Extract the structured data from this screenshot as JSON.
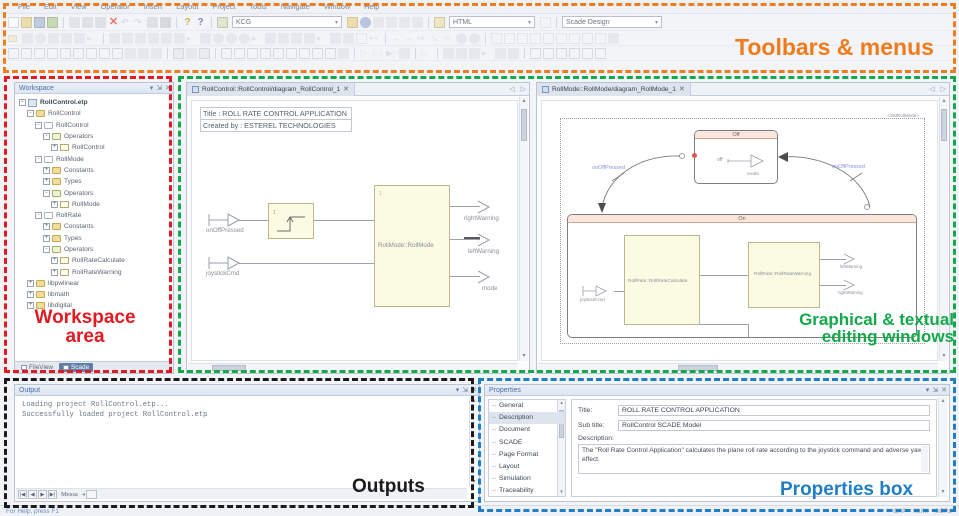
{
  "menubar": {
    "items": [
      "File",
      "Edit",
      "View",
      "Operator",
      "Insert",
      "Layout",
      "Project",
      "Tools",
      "Navigate",
      "Window",
      "Help"
    ]
  },
  "toolbar": {
    "kcg_combo": {
      "value": "KCG"
    },
    "html_combo": {
      "value": "HTML"
    },
    "design_combo": {
      "value": "Scade Design"
    }
  },
  "workspace": {
    "title": "Workspace",
    "tree": [
      {
        "label": "RollControl.etp",
        "depth": 0,
        "icon": "project",
        "expander": "-",
        "root": true
      },
      {
        "label": "RollControl",
        "depth": 1,
        "icon": "folder",
        "expander": "-"
      },
      {
        "label": "RollControl",
        "depth": 2,
        "icon": "white",
        "expander": "-"
      },
      {
        "label": "Operators",
        "depth": 3,
        "icon": "green",
        "expander": "-"
      },
      {
        "label": "RollControl",
        "depth": 4,
        "icon": "operator",
        "expander": "+"
      },
      {
        "label": "RollMode",
        "depth": 2,
        "icon": "white",
        "expander": "-"
      },
      {
        "label": "Constants",
        "depth": 3,
        "icon": "folder",
        "expander": "+"
      },
      {
        "label": "Types",
        "depth": 3,
        "icon": "folder",
        "expander": "+"
      },
      {
        "label": "Operators",
        "depth": 3,
        "icon": "green",
        "expander": "-"
      },
      {
        "label": "RollMode",
        "depth": 4,
        "icon": "operator",
        "expander": "+"
      },
      {
        "label": "RollRate",
        "depth": 2,
        "icon": "white",
        "expander": "-"
      },
      {
        "label": "Constants",
        "depth": 3,
        "icon": "folder",
        "expander": "+"
      },
      {
        "label": "Types",
        "depth": 3,
        "icon": "folder",
        "expander": "+"
      },
      {
        "label": "Operators",
        "depth": 3,
        "icon": "green",
        "expander": "-"
      },
      {
        "label": "RollRateCalculate",
        "depth": 4,
        "icon": "operator",
        "expander": "+"
      },
      {
        "label": "RollRateWarning",
        "depth": 4,
        "icon": "operator",
        "expander": "+"
      },
      {
        "label": "libpwlinear",
        "depth": 1,
        "icon": "folder",
        "expander": "+"
      },
      {
        "label": "libmath",
        "depth": 1,
        "icon": "folder",
        "expander": "+"
      },
      {
        "label": "libdigital",
        "depth": 1,
        "icon": "folder",
        "expander": "+"
      }
    ],
    "tabs": [
      {
        "label": "FileView",
        "selected": false
      },
      {
        "label": "Scade",
        "selected": true
      }
    ]
  },
  "editor_left": {
    "tab_label": "RollControl::RollControl/diagram_RollControl_1",
    "title_line1": "Title : ROLL RATE CONTROL APPLICATION",
    "title_line2": "Created by : ESTEREL TECHNOLOGIES",
    "inputs": [
      "onOffPressed",
      "joystickCmd"
    ],
    "block_label": "RollMode::RollMode",
    "outputs": [
      "rightWarning",
      "leftWarning",
      "mode"
    ]
  },
  "editor_right": {
    "tab_label": "RollMode::RollMode/diagram_RollMode_1",
    "frame_label": "<SMRollMode>",
    "state_off": {
      "name": "Off",
      "body_expr": "off",
      "body_out": "mode"
    },
    "state_on": {
      "name": "On"
    },
    "transitions": [
      "onOffPressed",
      "onOffPressed"
    ],
    "on_input": "joystickCmd",
    "blocks": [
      "RollRate::RollRateCalculate",
      "RollRate::RollRateWarning"
    ],
    "on_outputs": [
      "leftWarning",
      "rightWarning"
    ]
  },
  "output_panel": {
    "title": "Output",
    "lines": [
      "Loading project RollControl.etp...",
      "Successfully loaded project RollControl.etp"
    ],
    "tab_label": "Messa",
    "nav_buttons": [
      "|◀",
      "◀",
      "▶",
      "▶|"
    ]
  },
  "properties": {
    "title": "Properties",
    "list": [
      "General",
      "Description",
      "Document",
      "SCADE",
      "Page Format",
      "Layout",
      "Simulation",
      "Traceability"
    ],
    "selected": "Description",
    "fields": {
      "title_label": "Title:",
      "title_value": "ROLL RATE CONTROL APPLICATION",
      "subtitle_label": "Sub title:",
      "subtitle_value": "RollControl SCADE Model",
      "description_label": "Description:",
      "description_value": "The \"Roll Rate Control Application\" calculates the plane roll rate according to the joystick command and adverse yaw effect."
    }
  },
  "statusbar": {
    "help": "For Help, press F1",
    "keys": [
      "CAP",
      "NUM",
      "SCRL"
    ]
  },
  "annotations": [
    {
      "id": "toolbars",
      "label": "Toolbars & menus",
      "color": "#f07b1d"
    },
    {
      "id": "workspace",
      "label": "Workspace\narea",
      "color": "#e11b22"
    },
    {
      "id": "editors",
      "label": "Graphical & textual\nediting windows",
      "color": "#13a84a"
    },
    {
      "id": "outputs",
      "label": "Outputs",
      "color": "#1b1b1b"
    },
    {
      "id": "props",
      "label": "Properties box",
      "color": "#1f7ec4"
    }
  ]
}
